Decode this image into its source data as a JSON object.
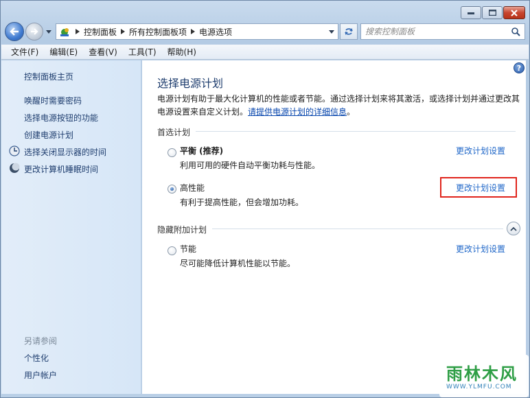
{
  "window": {
    "address_crumbs": [
      "控制面板",
      "所有控制面板项",
      "电源选项"
    ],
    "search_placeholder": "搜索控制面板"
  },
  "menu": {
    "items": [
      "文件(F)",
      "编辑(E)",
      "查看(V)",
      "工具(T)",
      "帮助(H)"
    ]
  },
  "sidebar": {
    "home": "控制面板主页",
    "links": [
      {
        "label": "唤醒时需要密码",
        "icon": null
      },
      {
        "label": "选择电源按钮的功能",
        "icon": null
      },
      {
        "label": "创建电源计划",
        "icon": null
      },
      {
        "label": "选择关闭显示器的时间",
        "icon": "monitor-clock-icon"
      },
      {
        "label": "更改计算机睡眠时间",
        "icon": "moon-icon"
      }
    ],
    "see_also": "另请参阅",
    "see_also_links": [
      "个性化",
      "用户帐户"
    ]
  },
  "main": {
    "title": "选择电源计划",
    "description": "电源计划有助于最大化计算机的性能或者节能。通过选择计划来将其激活，或选择计划并通过更改其电源设置来自定义计划。",
    "description_link": "请提供电源计划的详细信息",
    "description_end": "。",
    "preferred_group": "首选计划",
    "hidden_group": "隐藏附加计划",
    "plans": [
      {
        "name": "平衡 (推荐)",
        "desc": "利用可用的硬件自动平衡功耗与性能。",
        "link": "更改计划设置",
        "selected": false
      },
      {
        "name": "高性能",
        "desc": "有利于提高性能，但会增加功耗。",
        "link": "更改计划设置",
        "selected": true
      }
    ],
    "hidden_plans": [
      {
        "name": "节能",
        "desc": "尽可能降低计算机性能以节能。",
        "link": "更改计划设置",
        "selected": false
      }
    ],
    "help": "?"
  },
  "watermark": {
    "logo_text": "雨林木风",
    "url": "WWW.YLMFU.COM"
  },
  "colors": {
    "link": "#1e66c8",
    "highlight": "#e0231a",
    "sidebar_bg": "#d6e6f7"
  }
}
